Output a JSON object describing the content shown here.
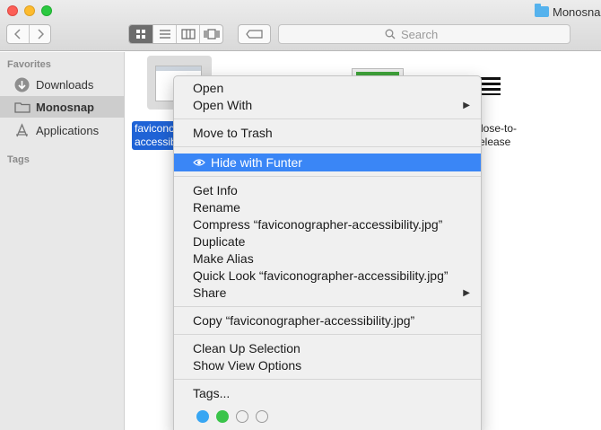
{
  "window": {
    "title": "Monosnap"
  },
  "search": {
    "placeholder": "Search"
  },
  "sidebar": {
    "favorites_heading": "Favorites",
    "items": [
      {
        "label": "Downloads",
        "icon": "download-icon"
      },
      {
        "label": "Monosnap",
        "icon": "folder-icon",
        "selected": true
      },
      {
        "label": "Applications",
        "icon": "applications-icon"
      }
    ],
    "tags_heading": "Tags"
  },
  "files": [
    {
      "label": "faviconographer-accessibility.jpg",
      "label_line1": "faviconographer-",
      "label_line2": "accessibility.jpg",
      "selected": true
    },
    {
      "label": "",
      "selected": false
    },
    {
      "label_line1": "close-to-",
      "label_line2": "release",
      "selected": false
    }
  ],
  "context_menu": {
    "open": "Open",
    "open_with": "Open With",
    "move_to_trash": "Move to Trash",
    "hide_with_funter": "Hide with Funter",
    "get_info": "Get Info",
    "rename": "Rename",
    "compress": "Compress “faviconographer-accessibility.jpg”",
    "duplicate": "Duplicate",
    "make_alias": "Make Alias",
    "quick_look": "Quick Look “faviconographer-accessibility.jpg”",
    "share": "Share",
    "copy": "Copy “faviconographer-accessibility.jpg”",
    "clean_up_selection": "Clean Up Selection",
    "show_view_options": "Show View Options",
    "tags": "Tags...",
    "tag_colors": [
      "#38a6f3",
      "#3ac44a",
      "none",
      "none"
    ]
  },
  "colors": {
    "accent": "#3a86f6",
    "selection": "#1f63d6"
  }
}
